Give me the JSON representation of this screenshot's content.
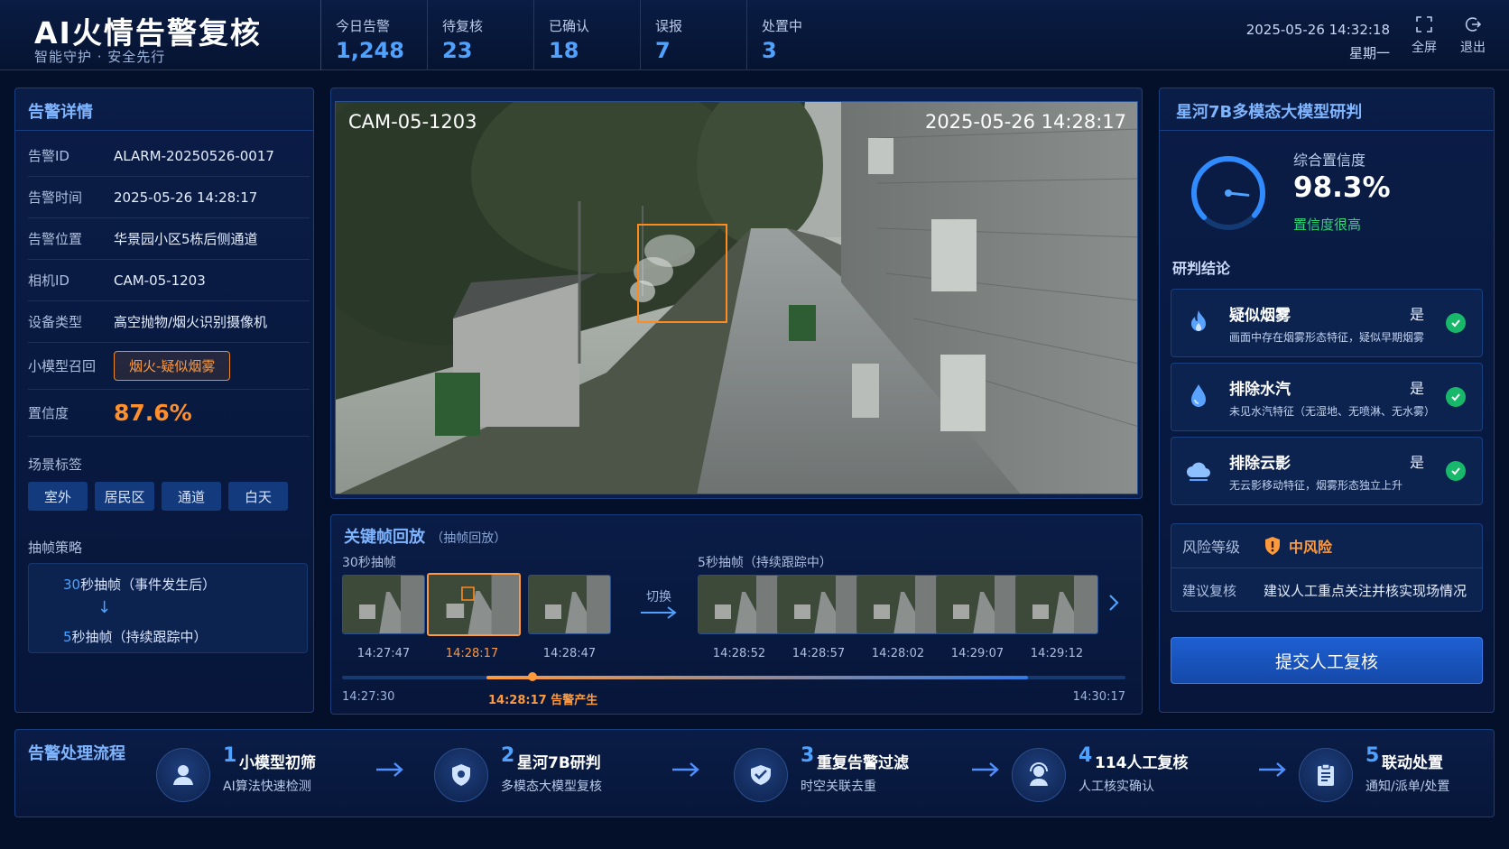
{
  "header": {
    "title": "AI火情告警复核",
    "subtitle": "智能守护 · 安全先行",
    "stats": [
      {
        "label": "今日告警",
        "value": "1,248"
      },
      {
        "label": "待复核",
        "value": "23"
      },
      {
        "label": "已确认",
        "value": "18"
      },
      {
        "label": "误报",
        "value": "7"
      },
      {
        "label": "处置中",
        "value": "3"
      }
    ],
    "datetime": "2025-05-26 14:32:18",
    "weekday": "星期一",
    "fullscreen_label": "全屏",
    "logout_label": "退出"
  },
  "alarm": {
    "title": "告警详情",
    "rows": [
      {
        "key": "告警ID",
        "value": "ALARM-20250526-0017"
      },
      {
        "key": "告警时间",
        "value": "2025-05-26 14:28:17"
      },
      {
        "key": "告警位置",
        "value": "华景园小区5栋后侧通道"
      },
      {
        "key": "相机ID",
        "value": "CAM-05-1203"
      },
      {
        "key": "设备类型",
        "value": "高空抛物/烟火识别摄像机"
      }
    ],
    "model_recall_key": "小模型召回",
    "model_recall_value": "烟火-疑似烟雾",
    "confidence_key": "置信度",
    "confidence_value": "87.6%",
    "scene_label": "场景标签",
    "scene_tags": [
      "室外",
      "居民区",
      "通道",
      "白天"
    ],
    "strategy_label": "抽帧策略",
    "strategy_1_num": "30",
    "strategy_1_text": "秒抽帧（事件发生后）",
    "strategy_2_num": "5",
    "strategy_2_text": "秒抽帧（持续跟踪中）"
  },
  "video": {
    "camera_id": "CAM-05-1203",
    "timestamp": "2025-05-26  14:28:17"
  },
  "keyframes": {
    "title": "关键帧回放",
    "subtitle": "（抽帧回放）",
    "group1_label": "30秒抽帧",
    "group2_label": "5秒抽帧（持续跟踪中）",
    "switch_label": "切换",
    "group1_times": [
      "14:27:47",
      "14:28:17",
      "14:28:47"
    ],
    "group2_times": [
      "14:28:52",
      "14:28:57",
      "14:28:02",
      "14:29:07",
      "14:29:12"
    ],
    "timeline_start": "14:27:30",
    "timeline_end": "14:30:17",
    "timeline_event": "14:28:17 告警产生"
  },
  "model": {
    "title": "星河7B多模态大模型研判",
    "confidence_label": "综合置信度",
    "confidence_value": "98.3%",
    "confidence_level": 0.983,
    "confidence_state": "置信度很高",
    "conclusion_label": "研判结论",
    "conclusions": [
      {
        "title": "疑似烟雾",
        "desc": "画面中存在烟雾形态特征，疑似早期烟雾",
        "result": "是",
        "icon": "fire-icon"
      },
      {
        "title": "排除水汽",
        "desc": "未见水汽特征（无湿地、无喷淋、无水雾）",
        "result": "是",
        "icon": "water-drop-icon"
      },
      {
        "title": "排除云影",
        "desc": "无云影移动特征，烟雾形态独立上升",
        "result": "是",
        "icon": "cloud-icon"
      }
    ],
    "risk_key": "风险等级",
    "risk_value": "中风险",
    "suggest_key": "建议复核",
    "suggest_value": "建议人工重点关注并核实现场情况",
    "submit_label": "提交人工复核"
  },
  "flow": {
    "title": "告警处理流程",
    "steps": [
      {
        "num": "1",
        "name": "小模型初筛",
        "desc": "AI算法快速检测",
        "icon": "user-icon"
      },
      {
        "num": "2",
        "name": "星河7B研判",
        "desc": "多模态大模型复核",
        "icon": "shield-icon"
      },
      {
        "num": "3",
        "name": "重复告警过滤",
        "desc": "时空关联去重",
        "icon": "filter-icon"
      },
      {
        "num": "4",
        "name": "114人工复核",
        "desc": "人工核实确认",
        "icon": "operator-icon"
      },
      {
        "num": "5",
        "name": "联动处置",
        "desc": "通知/派单/处置",
        "icon": "clipboard-icon"
      }
    ]
  },
  "colors": {
    "accent": "#4fa2ff",
    "warning": "#ff9a3c",
    "success": "#18b86a",
    "background": "#041029"
  }
}
